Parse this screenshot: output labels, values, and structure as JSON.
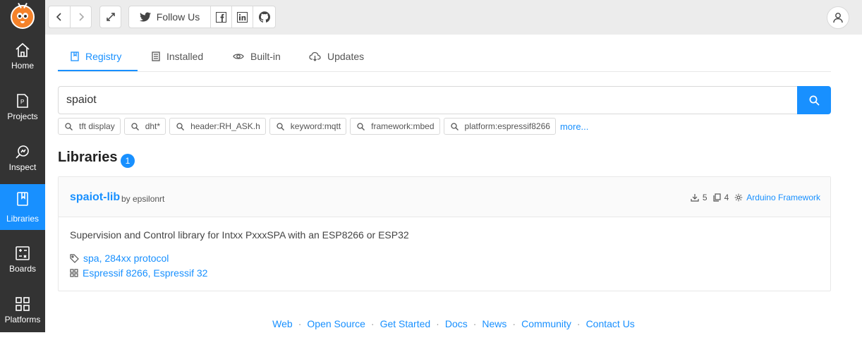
{
  "sidebar": {
    "items": [
      {
        "label": "Home",
        "icon": "home-icon"
      },
      {
        "label": "Projects",
        "icon": "projects-icon"
      },
      {
        "label": "Inspect",
        "icon": "inspect-icon"
      },
      {
        "label": "Libraries",
        "icon": "libraries-icon",
        "active": true
      },
      {
        "label": "Boards",
        "icon": "boards-icon"
      },
      {
        "label": "Platforms",
        "icon": "platforms-icon"
      }
    ]
  },
  "toolbar": {
    "follow_label": "Follow Us",
    "social": [
      "facebook-icon",
      "linkedin-icon",
      "github-icon"
    ]
  },
  "tabs": [
    {
      "label": "Registry",
      "icon": "book-icon",
      "active": true
    },
    {
      "label": "Installed",
      "icon": "list-icon"
    },
    {
      "label": "Built-in",
      "icon": "eye-icon"
    },
    {
      "label": "Updates",
      "icon": "cloud-download-icon"
    }
  ],
  "search": {
    "value": "spaiot"
  },
  "chips": [
    "tft display",
    "dht*",
    "header:RH_ASK.h",
    "keyword:mqtt",
    "framework:mbed",
    "platform:espressif8266"
  ],
  "more_label": "more...",
  "libraries": {
    "title": "Libraries",
    "count": "1"
  },
  "result": {
    "name": "spaiot-lib",
    "by": "by epsilonrt",
    "downloads": "5",
    "examples": "4",
    "framework": "Arduino Framework",
    "description": "Supervision and Control library for Intxx PxxxSPA with an ESP8266 or ESP32",
    "keywords": "spa, 284xx protocol",
    "platforms": "Espressif 8266, Espressif 32"
  },
  "footer": [
    "Web",
    "Open Source",
    "Get Started",
    "Docs",
    "News",
    "Community",
    "Contact Us"
  ],
  "colors": {
    "accent": "#1890ff",
    "sidebar": "#333333",
    "topbar": "#ececec",
    "logo": "#f5822a"
  }
}
